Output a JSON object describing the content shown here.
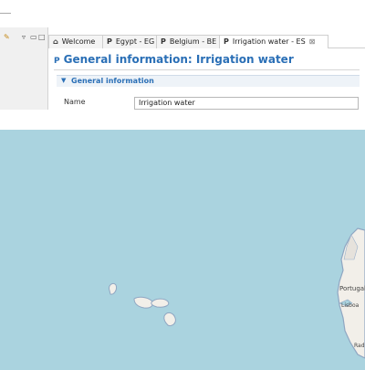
{
  "left_panel": {
    "toolbar_icons": [
      "tool-icon",
      "menu-icon",
      "minimize-icon",
      "maximize-icon"
    ]
  },
  "editor": {
    "tabs": [
      {
        "prefix": "⌂",
        "label": "Welcome",
        "active": false
      },
      {
        "prefix": "P",
        "label": "Egypt - EG",
        "active": false
      },
      {
        "prefix": "P",
        "label": "Belgium - BE",
        "active": false
      },
      {
        "prefix": "P",
        "label": "Irrigation water - ES",
        "active": true,
        "close": "⊠"
      }
    ],
    "form_title_prefix": "P",
    "form_title": "General information: Irrigation water",
    "section": {
      "label": "General information"
    },
    "fields": [
      {
        "label": "Name",
        "value": "Irrigation water"
      }
    ]
  },
  "map": {
    "labels": {
      "portugal": "Portugal",
      "lisboa": "Lisboa",
      "rad": "Rad"
    },
    "colors": {
      "sea": "#aad3df",
      "land": "#f2efe9",
      "coast": "#8fa6c2"
    }
  }
}
